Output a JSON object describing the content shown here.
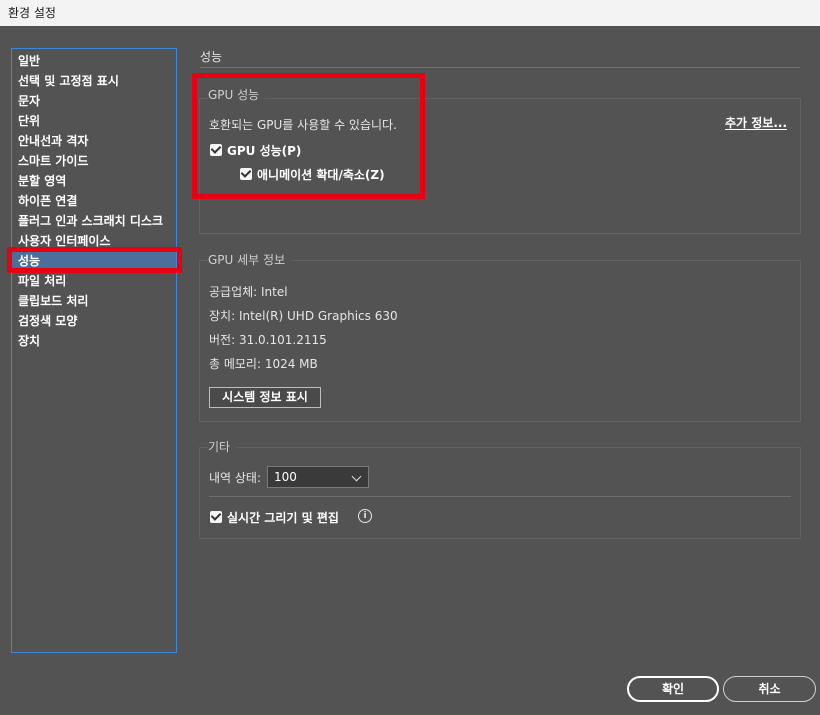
{
  "window": {
    "title": "환경 설정"
  },
  "sidebar": {
    "items": [
      {
        "label": "일반"
      },
      {
        "label": "선택 및 고정점 표시"
      },
      {
        "label": "문자"
      },
      {
        "label": "단위"
      },
      {
        "label": "안내선과 격자"
      },
      {
        "label": "스마트 가이드"
      },
      {
        "label": "분할 영역"
      },
      {
        "label": "하이픈 연결"
      },
      {
        "label": "플러그 인과 스크래치 디스크"
      },
      {
        "label": "사용자 인터페이스"
      },
      {
        "label": "성능"
      },
      {
        "label": "파일 처리"
      },
      {
        "label": "클립보드 처리"
      },
      {
        "label": "검정색 모양"
      },
      {
        "label": "장치"
      }
    ],
    "selected": "성능"
  },
  "main": {
    "section_title": "성능",
    "gpu_performance": {
      "group_label": "GPU 성능",
      "description": "호환되는 GPU를 사용할 수 있습니다.",
      "more_info": "추가 정보...",
      "gpu_checkbox_label": "GPU 성능(P)",
      "animation_checkbox_label": "애니메이션 확대/축소(Z)"
    },
    "gpu_details": {
      "group_label": "GPU 세부 정보",
      "vendor": "공급업체: Intel",
      "device": "장치: Intel(R) UHD Graphics 630",
      "version": "버전: 31.0.101.2115",
      "memory": "총 메모리: 1024 MB",
      "system_info_button": "시스템 정보 표시"
    },
    "misc": {
      "group_label": "기타",
      "history_label": "내역 상태:",
      "history_value": "100",
      "realtime_label": "실시간 그리기 및 편집",
      "info_glyph": "i"
    }
  },
  "footer": {
    "ok": "확인",
    "cancel": "취소"
  },
  "colors": {
    "highlight": "#e60012",
    "selection": "#4b6f9a",
    "focus_border": "#3f86d8"
  }
}
